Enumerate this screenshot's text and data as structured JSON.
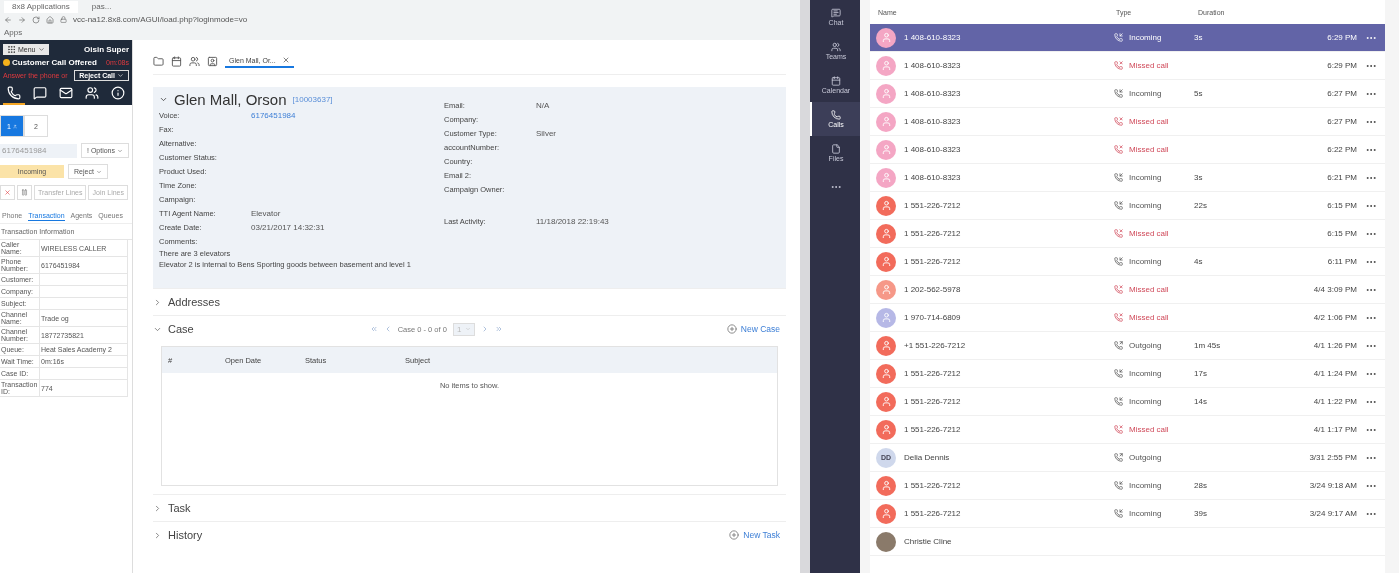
{
  "browser": {
    "tabs": [
      {
        "label": "8x8 Applications",
        "selected": true
      },
      {
        "label": "pas...",
        "selected": false
      }
    ],
    "address": "vcc-na12.8x8.com/AGUI/load.php?loginmode=vo",
    "bookmarks": [
      "Apps"
    ]
  },
  "agent": {
    "menu": "Menu",
    "user": "Oisin Super",
    "status": "Customer Call Offered",
    "timer": "0m:08s",
    "prompt": "Answer the phone or",
    "reject_call": "Reject Call",
    "icon_tabs": [
      {
        "kind": "phone",
        "selected": true
      },
      {
        "kind": "chat",
        "selected": false
      },
      {
        "kind": "mail",
        "selected": false
      },
      {
        "kind": "people",
        "selected": false
      },
      {
        "kind": "info",
        "selected": false
      }
    ],
    "lines": [
      {
        "label": "1",
        "selected": true
      },
      {
        "label": "2",
        "selected": false
      }
    ],
    "phone_number": "6176451984",
    "options": "! Options",
    "call_state": "Incoming",
    "reject": "Reject",
    "transfer": "Transfer Lines",
    "join": "Join Lines",
    "tabs": [
      {
        "label": "Phone",
        "selected": false
      },
      {
        "label": "Transaction",
        "selected": true
      },
      {
        "label": "Agents",
        "selected": false
      },
      {
        "label": "Queues",
        "selected": false
      }
    ],
    "info_title": "Transaction Information",
    "info": [
      {
        "label": "Caller Name:",
        "value": "WIRELESS CALLER"
      },
      {
        "label": "Phone Number:",
        "value": "6176451984"
      },
      {
        "label": "Customer:"
      },
      {
        "label": "Company:"
      },
      {
        "label": "Subject:"
      },
      {
        "label": "Channel Name:",
        "value": "Trade og"
      },
      {
        "label": "Channel Number:",
        "value": "18772735821"
      },
      {
        "label": "Queue:",
        "value": "Heat Sales Academy 2"
      },
      {
        "label": "Wait Time:",
        "value": "0m:16s"
      },
      {
        "label": "Case ID:"
      },
      {
        "label": "Transaction ID:",
        "value": "774"
      }
    ]
  },
  "main": {
    "tools": [
      {
        "kind": "folder"
      },
      {
        "kind": "calendar"
      },
      {
        "kind": "people"
      },
      {
        "kind": "contact"
      }
    ],
    "tabs": [
      {
        "label": "Glen Mall, Or...",
        "selected": true
      }
    ],
    "contact": {
      "name": "Glen Mall, Orson",
      "id": "[10003637]",
      "expanded": true,
      "left": [
        {
          "label": "Voice:",
          "value": "6176451984",
          "kind": "link"
        },
        {
          "label": "Fax:"
        },
        {
          "label": "Alternative:"
        },
        {
          "label": "Customer Status:"
        },
        {
          "label": "Product Used:"
        },
        {
          "label": "Time Zone:"
        },
        {
          "label": "Campaign:"
        },
        {
          "label": "TTI Agent Name:",
          "value": "Elevator",
          "kind": "text"
        },
        {
          "label": "Create Date:",
          "value": "03/21/2017 14:32:31",
          "kind": "text"
        },
        {
          "label": "Comments:"
        }
      ],
      "right": [
        {
          "label": "Email:",
          "value": "N/A"
        },
        {
          "label": "Company:"
        },
        {
          "label": "Customer Type:",
          "value": "Silver"
        },
        {
          "label": "accountNumber:"
        },
        {
          "label": "Country:"
        },
        {
          "label": "Email 2:"
        },
        {
          "label": "Campaign Owner:"
        },
        {
          "label": "Last Activity:",
          "value": "11/18/2018 22:19:43"
        }
      ],
      "comments": [
        "There are 3 elevators",
        "Elevator 2 is internal to Bens Sporting goods between basement and level 1"
      ]
    },
    "sections": [
      {
        "title": "Addresses",
        "expanded": false
      },
      {
        "title": "Case",
        "expanded": true,
        "pager": "Case 0 - 0 of 0",
        "page": "1",
        "action": "New Case",
        "columns": [
          "#",
          "Open Date",
          "Status",
          "Subject"
        ],
        "empty": "No items to show."
      },
      {
        "title": "Task",
        "expanded": false
      },
      {
        "title": "History",
        "expanded": false,
        "action": "New Task"
      }
    ]
  },
  "rail": [
    {
      "label": "Chat",
      "kind": "chat",
      "selected": false
    },
    {
      "label": "Teams",
      "kind": "teams",
      "selected": false
    },
    {
      "label": "Calendar",
      "kind": "calendar",
      "selected": false
    },
    {
      "label": "Calls",
      "kind": "calls",
      "selected": true
    },
    {
      "label": "Files",
      "kind": "files",
      "selected": false
    },
    {
      "kind": "more",
      "selected": false
    }
  ],
  "calls": {
    "columns": [
      "Name",
      "Type",
      "Duration"
    ],
    "rows": [
      {
        "name": "1 408-610-8323",
        "kind": "incoming",
        "type": "Incoming",
        "duration": "3s",
        "time": "6:29 PM",
        "avatar": {
          "kind": "person",
          "color": "#f4a6c4"
        },
        "selected": true
      },
      {
        "name": "1 408-610-8323",
        "kind": "missed",
        "type": "Missed call",
        "time": "6:29 PM",
        "avatar": {
          "kind": "person",
          "color": "#f4a6c4"
        },
        "selected": false
      },
      {
        "name": "1 408-610-8323",
        "kind": "incoming",
        "type": "Incoming",
        "duration": "5s",
        "time": "6:27 PM",
        "avatar": {
          "kind": "person",
          "color": "#f4a6c4"
        },
        "selected": false
      },
      {
        "name": "1 408-610-8323",
        "kind": "missed",
        "type": "Missed call",
        "time": "6:27 PM",
        "avatar": {
          "kind": "person",
          "color": "#f4a6c4"
        },
        "selected": false
      },
      {
        "name": "1 408-610-8323",
        "kind": "missed",
        "type": "Missed call",
        "time": "6:22 PM",
        "avatar": {
          "kind": "person",
          "color": "#f4a6c4"
        },
        "selected": false
      },
      {
        "name": "1 408-610-8323",
        "kind": "incoming",
        "type": "Incoming",
        "duration": "3s",
        "time": "6:21 PM",
        "avatar": {
          "kind": "person",
          "color": "#f4a6c4"
        },
        "selected": false
      },
      {
        "name": "1 551-226-7212",
        "kind": "incoming",
        "type": "Incoming",
        "duration": "22s",
        "time": "6:15 PM",
        "avatar": {
          "kind": "person",
          "color": "#f26b5b"
        },
        "selected": false
      },
      {
        "name": "1 551-226-7212",
        "kind": "missed",
        "type": "Missed call",
        "time": "6:15 PM",
        "avatar": {
          "kind": "person",
          "color": "#f26b5b"
        },
        "selected": false
      },
      {
        "name": "1 551-226-7212",
        "kind": "incoming",
        "type": "Incoming",
        "duration": "4s",
        "time": "6:11 PM",
        "avatar": {
          "kind": "person",
          "color": "#f26b5b"
        },
        "selected": false
      },
      {
        "name": "1 202-562-5978",
        "kind": "missed",
        "type": "Missed call",
        "time": "4/4 3:09 PM",
        "avatar": {
          "kind": "person",
          "color": "#f69888"
        },
        "selected": false
      },
      {
        "name": "1 970-714-6809",
        "kind": "missed",
        "type": "Missed call",
        "time": "4/2 1:06 PM",
        "avatar": {
          "kind": "person",
          "color": "#b6b8e6"
        },
        "selected": false
      },
      {
        "name": "+1 551-226-7212",
        "kind": "outgoing",
        "type": "Outgoing",
        "duration": "1m 45s",
        "time": "4/1 1:26 PM",
        "avatar": {
          "kind": "person",
          "color": "#f26b5b"
        },
        "selected": false
      },
      {
        "name": "1 551-226-7212",
        "kind": "incoming",
        "type": "Incoming",
        "duration": "17s",
        "time": "4/1 1:24 PM",
        "avatar": {
          "kind": "person",
          "color": "#f26b5b"
        },
        "selected": false
      },
      {
        "name": "1 551-226-7212",
        "kind": "incoming",
        "type": "Incoming",
        "duration": "14s",
        "time": "4/1 1:22 PM",
        "avatar": {
          "kind": "person",
          "color": "#f26b5b"
        },
        "selected": false
      },
      {
        "name": "1 551-226-7212",
        "kind": "missed",
        "type": "Missed call",
        "time": "4/1 1:17 PM",
        "avatar": {
          "kind": "person",
          "color": "#f26b5b"
        },
        "selected": false
      },
      {
        "name": "Delia Dennis",
        "kind": "outgoing",
        "type": "Outgoing",
        "time": "3/31 2:55 PM",
        "avatar": {
          "kind": "initials",
          "initials": "DD",
          "color": "#cfd8ec"
        },
        "selected": false
      },
      {
        "name": "1 551-226-7212",
        "kind": "incoming",
        "type": "Incoming",
        "duration": "28s",
        "time": "3/24 9:18 AM",
        "avatar": {
          "kind": "person",
          "color": "#f26b5b"
        },
        "selected": false
      },
      {
        "name": "1 551-226-7212",
        "kind": "incoming",
        "type": "Incoming",
        "duration": "39s",
        "time": "3/24 9:17 AM",
        "avatar": {
          "kind": "person",
          "color": "#f26b5b"
        },
        "selected": false
      },
      {
        "name": "Christie Cline",
        "kind": "none",
        "avatar": {
          "kind": "photo",
          "color": "#8a7a6a"
        },
        "selected": false
      }
    ]
  }
}
